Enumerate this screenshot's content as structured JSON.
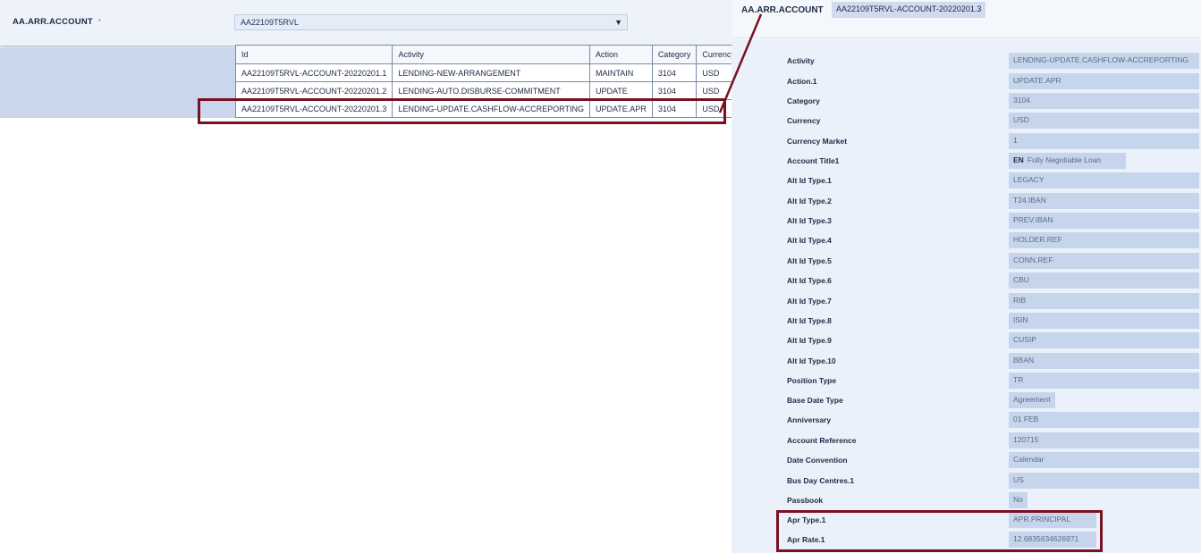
{
  "left": {
    "field_label": "AA.ARR.ACCOUNT",
    "required_marker": "*",
    "select_value": "AA22109T5RVL",
    "dropdown_icon": "chevron-down-icon",
    "table": {
      "headers": [
        "Id",
        "Activity",
        "Action",
        "Category",
        "Currency"
      ],
      "rows": [
        [
          "AA22109T5RVL-ACCOUNT-20220201.1",
          "LENDING-NEW-ARRANGEMENT",
          "MAINTAIN",
          "3104",
          "USD"
        ],
        [
          "AA22109T5RVL-ACCOUNT-20220201.2",
          "LENDING-AUTO.DISBURSE-COMMITMENT",
          "UPDATE",
          "3104",
          "USD"
        ],
        [
          "AA22109T5RVL-ACCOUNT-20220201.3",
          "LENDING-UPDATE.CASHFLOW-ACCREPORTING",
          "UPDATE.APR",
          "3104",
          "USD"
        ]
      ]
    }
  },
  "right": {
    "header_label": "AA.ARR.ACCOUNT",
    "header_value": "AA22109T5RVL-ACCOUNT-20220201.3",
    "fields": [
      {
        "label": "Activity",
        "value": "LENDING-UPDATE.CASHFLOW-ACCREPORTING"
      },
      {
        "label": "Action.1",
        "value": "UPDATE.APR"
      },
      {
        "label": "Category",
        "value": "3104"
      },
      {
        "label": "Currency",
        "value": "USD"
      },
      {
        "label": "Currency Market",
        "value": "1"
      },
      {
        "label": "Account Title1",
        "lang": "EN",
        "value": "Fully Negotiable Loan"
      },
      {
        "label": "Alt Id Type.1",
        "value": "LEGACY"
      },
      {
        "label": "Alt Id Type.2",
        "value": "T24.IBAN"
      },
      {
        "label": "Alt Id Type.3",
        "value": "PREV.IBAN"
      },
      {
        "label": "Alt Id Type.4",
        "value": "HOLDER.REF"
      },
      {
        "label": "Alt Id Type.5",
        "value": "CONN.REF"
      },
      {
        "label": "Alt Id Type.6",
        "value": "CBU"
      },
      {
        "label": "Alt Id Type.7",
        "value": "RIB"
      },
      {
        "label": "Alt Id Type.8",
        "value": "ISIN"
      },
      {
        "label": "Alt Id Type.9",
        "value": "CUSIP"
      },
      {
        "label": "Alt Id Type.10",
        "value": "BBAN"
      },
      {
        "label": "Position Type",
        "value": "TR"
      },
      {
        "label": "Base Date Type",
        "value": "Agreement"
      },
      {
        "label": "Anniversary",
        "value": "01 FEB"
      },
      {
        "label": "Account Reference",
        "value": "120715"
      },
      {
        "label": "Date Convention",
        "value": "Calendar"
      },
      {
        "label": "Bus Day Centres.1",
        "value": "US"
      },
      {
        "label": "Passbook",
        "value": "No"
      },
      {
        "label": "Apr Type.1",
        "value": "APR.PRINCIPAL"
      },
      {
        "label": "Apr Rate.1",
        "value": "12.6835634626971"
      }
    ]
  },
  "colors": {
    "highlight_border": "#7b1020",
    "panel_bg": "#eaf1fa",
    "value_bg": "#c6d5ec"
  }
}
